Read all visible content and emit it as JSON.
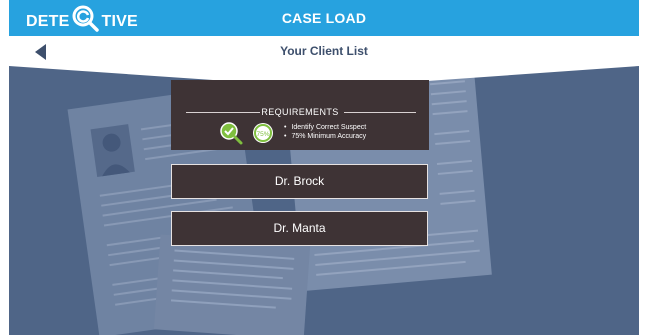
{
  "header": {
    "logo_text_left": "DETE",
    "logo_text_right": "TIVE",
    "title": "CASE LOAD"
  },
  "subheader": {
    "title": "Your Client List",
    "back_icon": "back-arrow-icon"
  },
  "requirements": {
    "title": "REQUIREMENTS",
    "badge_percent": "75%",
    "items": [
      "Identify Correct Suspect",
      "75% Minimum Accuracy"
    ]
  },
  "clients": [
    {
      "name": "Dr. Brock"
    },
    {
      "name": "Dr. Manta"
    }
  ],
  "colors": {
    "topbar": "#27a2df",
    "background": "#4f6587",
    "panel": "#3e3335",
    "check_green": "#7fbf3f"
  }
}
